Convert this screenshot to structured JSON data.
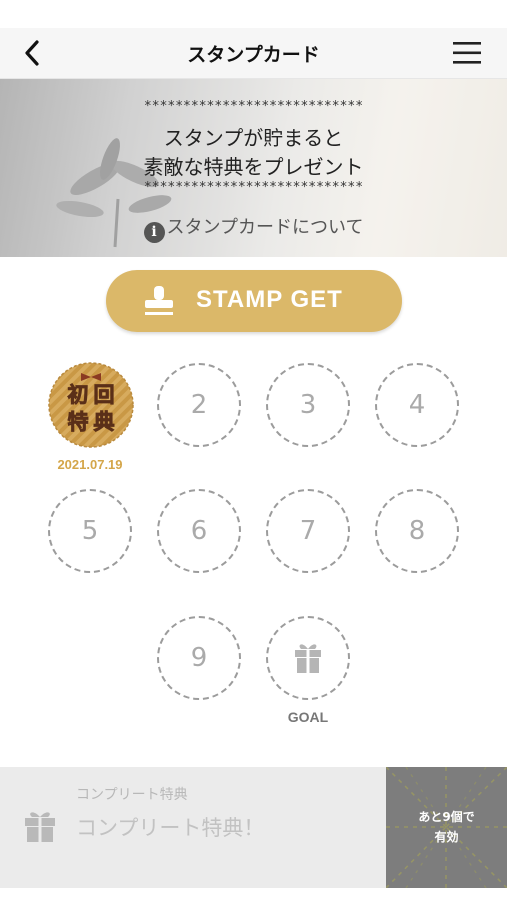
{
  "header": {
    "title": "スタンプカード",
    "back_icon": "chevron-left-icon",
    "menu_icon": "hamburger-menu-icon"
  },
  "hero": {
    "stars_top": "****************************",
    "line1": "スタンプが貯まると",
    "line2": "素敵な特典をプレゼント",
    "stars_bottom": "****************************",
    "about_link": "スタンプカードについて",
    "about_icon": "info-icon"
  },
  "stamp_button": {
    "label": "STAMP GET",
    "icon": "stamp-icon",
    "color": "#dbb869"
  },
  "stamps": {
    "first": {
      "char1": "初",
      "char2": "回",
      "char3": "特",
      "char4": "典",
      "date": "2021.07.19"
    },
    "slots": [
      "2",
      "3",
      "4",
      "5",
      "6",
      "7",
      "8",
      "9"
    ],
    "goal_label": "GOAL",
    "goal_icon": "gift-icon"
  },
  "complete": {
    "caption": "コンプリート特典",
    "title": "コンプリート特典！",
    "icon": "gift-icon",
    "thumb_line1": "あと9個で",
    "thumb_line2": "有効"
  },
  "colors": {
    "gold": "#dbb869",
    "date_gold": "#d4a64a",
    "dashed": "#9c9c9c"
  }
}
